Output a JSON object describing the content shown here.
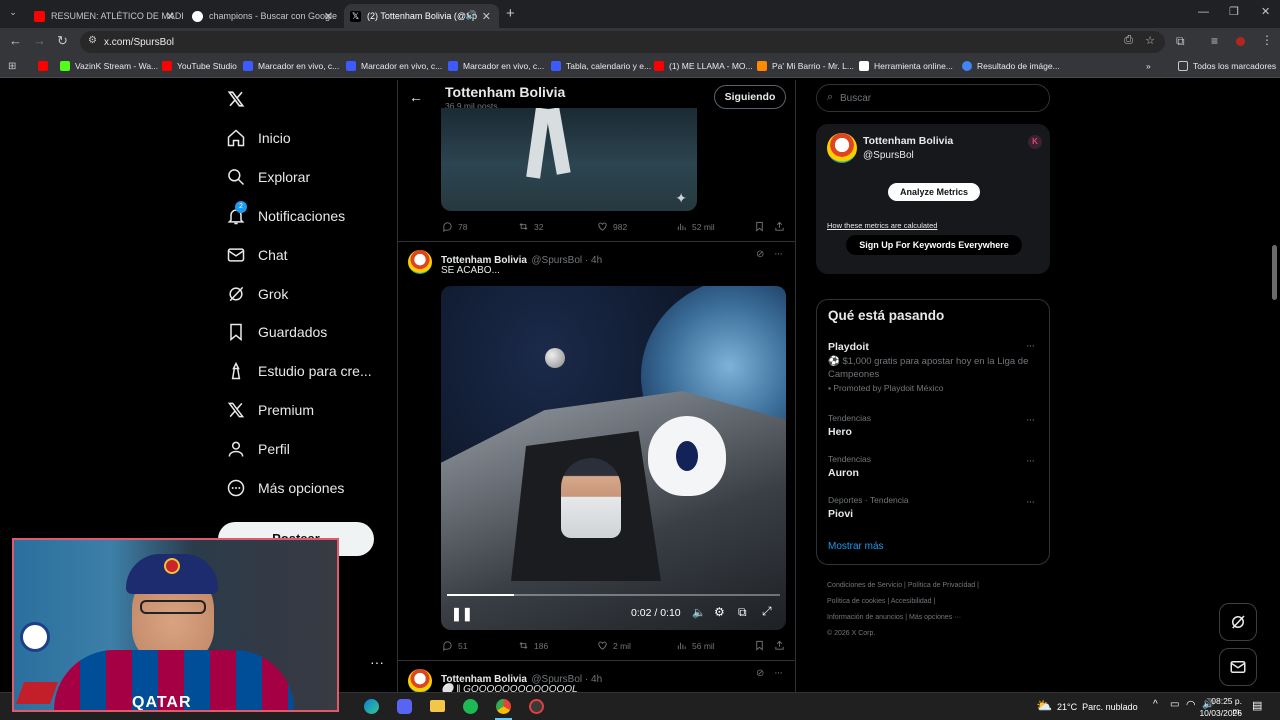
{
  "browser": {
    "tabs": [
      {
        "label": "RESUMEN: ATLÉTICO DE MADR",
        "favicon": "youtube-icon",
        "color": "#ff0000"
      },
      {
        "label": "champions - Buscar con Google",
        "favicon": "google-icon",
        "color": "#ffffff"
      },
      {
        "label": "(2) Tottenham Bolivia (@Sp",
        "favicon": "x-icon",
        "color": "#000000"
      }
    ],
    "url": "x.com/SpursBol",
    "bookmarks": [
      {
        "label": "",
        "color": "#ff0000"
      },
      {
        "label": "VazinK Stream - Wa...",
        "color": "#53fc18"
      },
      {
        "label": "YouTube Studio",
        "color": "#ff0000"
      },
      {
        "label": "Marcador en vivo, c...",
        "color": "#3d5afe"
      },
      {
        "label": "Marcador en vivo, c...",
        "color": "#3d5afe"
      },
      {
        "label": "Marcador en vivo, c...",
        "color": "#3d5afe"
      },
      {
        "label": "Tabla, calendario y e...",
        "color": "#3d5afe"
      },
      {
        "label": "(1) ME LLAMA - MO...",
        "color": "#ff0000"
      },
      {
        "label": "Pa' Mi Barrio - Mr. L...",
        "color": "#ff8a00"
      },
      {
        "label": "Herramienta online...",
        "color": "#ffffff"
      },
      {
        "label": "Resultado de imáge...",
        "color": "#4285f4"
      }
    ],
    "all_bookmarks": "Todos los marcadores"
  },
  "sidebar": {
    "items": [
      {
        "label": "Inicio",
        "icon": "home-icon"
      },
      {
        "label": "Explorar",
        "icon": "search-icon"
      },
      {
        "label": "Notificaciones",
        "icon": "bell-icon",
        "badge": "2"
      },
      {
        "label": "Chat",
        "icon": "mail-icon"
      },
      {
        "label": "Grok",
        "icon": "grok-icon"
      },
      {
        "label": "Guardados",
        "icon": "bookmark-icon"
      },
      {
        "label": "Estudio para cre...",
        "icon": "studio-icon"
      },
      {
        "label": "Premium",
        "icon": "x-logo-icon"
      },
      {
        "label": "Perfil",
        "icon": "person-icon"
      },
      {
        "label": "Más opciones",
        "icon": "more-circle-icon"
      }
    ],
    "post_label": "Postear"
  },
  "header": {
    "title": "Tottenham Bolivia",
    "subtitle": "36,9 mil posts",
    "follow_label": "Siguiendo"
  },
  "tweet1": {
    "replies": "78",
    "reposts": "32",
    "likes": "982",
    "views": "52 mil"
  },
  "tweet2": {
    "name": "Tottenham Bolivia",
    "handle": "@SpursBol · 4h",
    "text": "SE ACABO...",
    "video_time": "0:02 / 0:10",
    "progress": 0.2,
    "replies": "51",
    "reposts": "186",
    "likes": "2 mil",
    "views": "56 mil"
  },
  "tweet3": {
    "name": "Tottenham Bolivia",
    "handle": "@SpursBol · 4h",
    "text": "⚪ ‖ GOOOOOOOOOOOOOL"
  },
  "right": {
    "search_placeholder": "Buscar",
    "profile_name": "Tottenham Bolivia",
    "profile_handle": "@SpursBol",
    "analyze_label": "Analyze Metrics",
    "metrics_link": "How these metrics are calculated",
    "signup_label": "Sign Up For Keywords Everywhere",
    "trends_title": "Qué está pasando",
    "promo_name": "Playdoit",
    "promo_text": "⚽ $1,000 gratis para apostar hoy en la Liga de Campeones",
    "promo_by": "Promoted by Playdoit México",
    "trends": [
      {
        "meta": "Tendencias",
        "name": "Hero"
      },
      {
        "meta": "Tendencias",
        "name": "Auron"
      },
      {
        "meta": "Deportes · Tendencia",
        "name": "Piovi"
      }
    ],
    "show_more": "Mostrar más",
    "footer": [
      "Condiciones de Servicio",
      "Política de Privacidad",
      "Política de cookies",
      "Accesibilidad",
      "Información de anuncios",
      "Más opciones ···",
      "© 2026 X Corp."
    ]
  },
  "taskbar": {
    "weather": "21°C  Parc. nublado",
    "time": "08:25 p. m.",
    "date": "10/03/2026"
  }
}
